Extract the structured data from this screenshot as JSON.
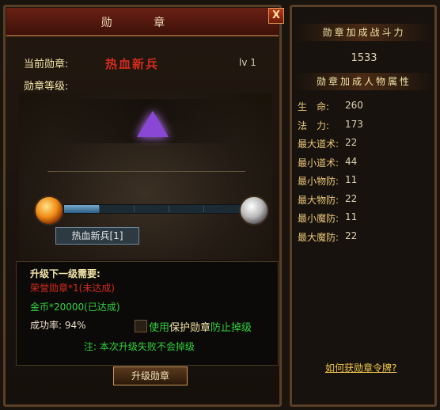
{
  "window": {
    "title": "勋 章",
    "close_label": "X"
  },
  "medal": {
    "current_label": "当前勋章:",
    "current_name": "热血新兵",
    "level": "lv 1",
    "level_label": "勋章等级:",
    "tag": "热血新兵[1]",
    "progress_fraction": 0.2
  },
  "requirements": {
    "title": "升级下一级需要:",
    "honor": "荣誉勋章*1(未达成)",
    "gold": "金币*20000(已达成)",
    "success_rate": "成功率: 94%",
    "protect_prefix": "使用",
    "protect_item": "保护勋章",
    "protect_suffix": "防止掉级",
    "protect_checked": false,
    "note": "注: 本次升级失败不会掉级",
    "upgrade_button": "升级勋章"
  },
  "side": {
    "power_title": "勋章加成战斗力",
    "power_value": "1533",
    "attr_title": "勋章加成人物属性",
    "attributes": [
      {
        "name": "生　命:",
        "value": "260"
      },
      {
        "name": "法　力:",
        "value": "173"
      },
      {
        "name": "最大道术:",
        "value": "22"
      },
      {
        "name": "最小道术:",
        "value": "44"
      },
      {
        "name": "最小物防:",
        "value": "11"
      },
      {
        "name": "最大物防:",
        "value": "22"
      },
      {
        "name": "最小魔防:",
        "value": "11"
      },
      {
        "name": "最大魔防:",
        "value": "22"
      }
    ],
    "how_to_link": "如何获勋章令牌?"
  },
  "colors": {
    "accent_red": "#d32b1d",
    "green": "#2fd03c",
    "gold": "#f4e6a8"
  }
}
